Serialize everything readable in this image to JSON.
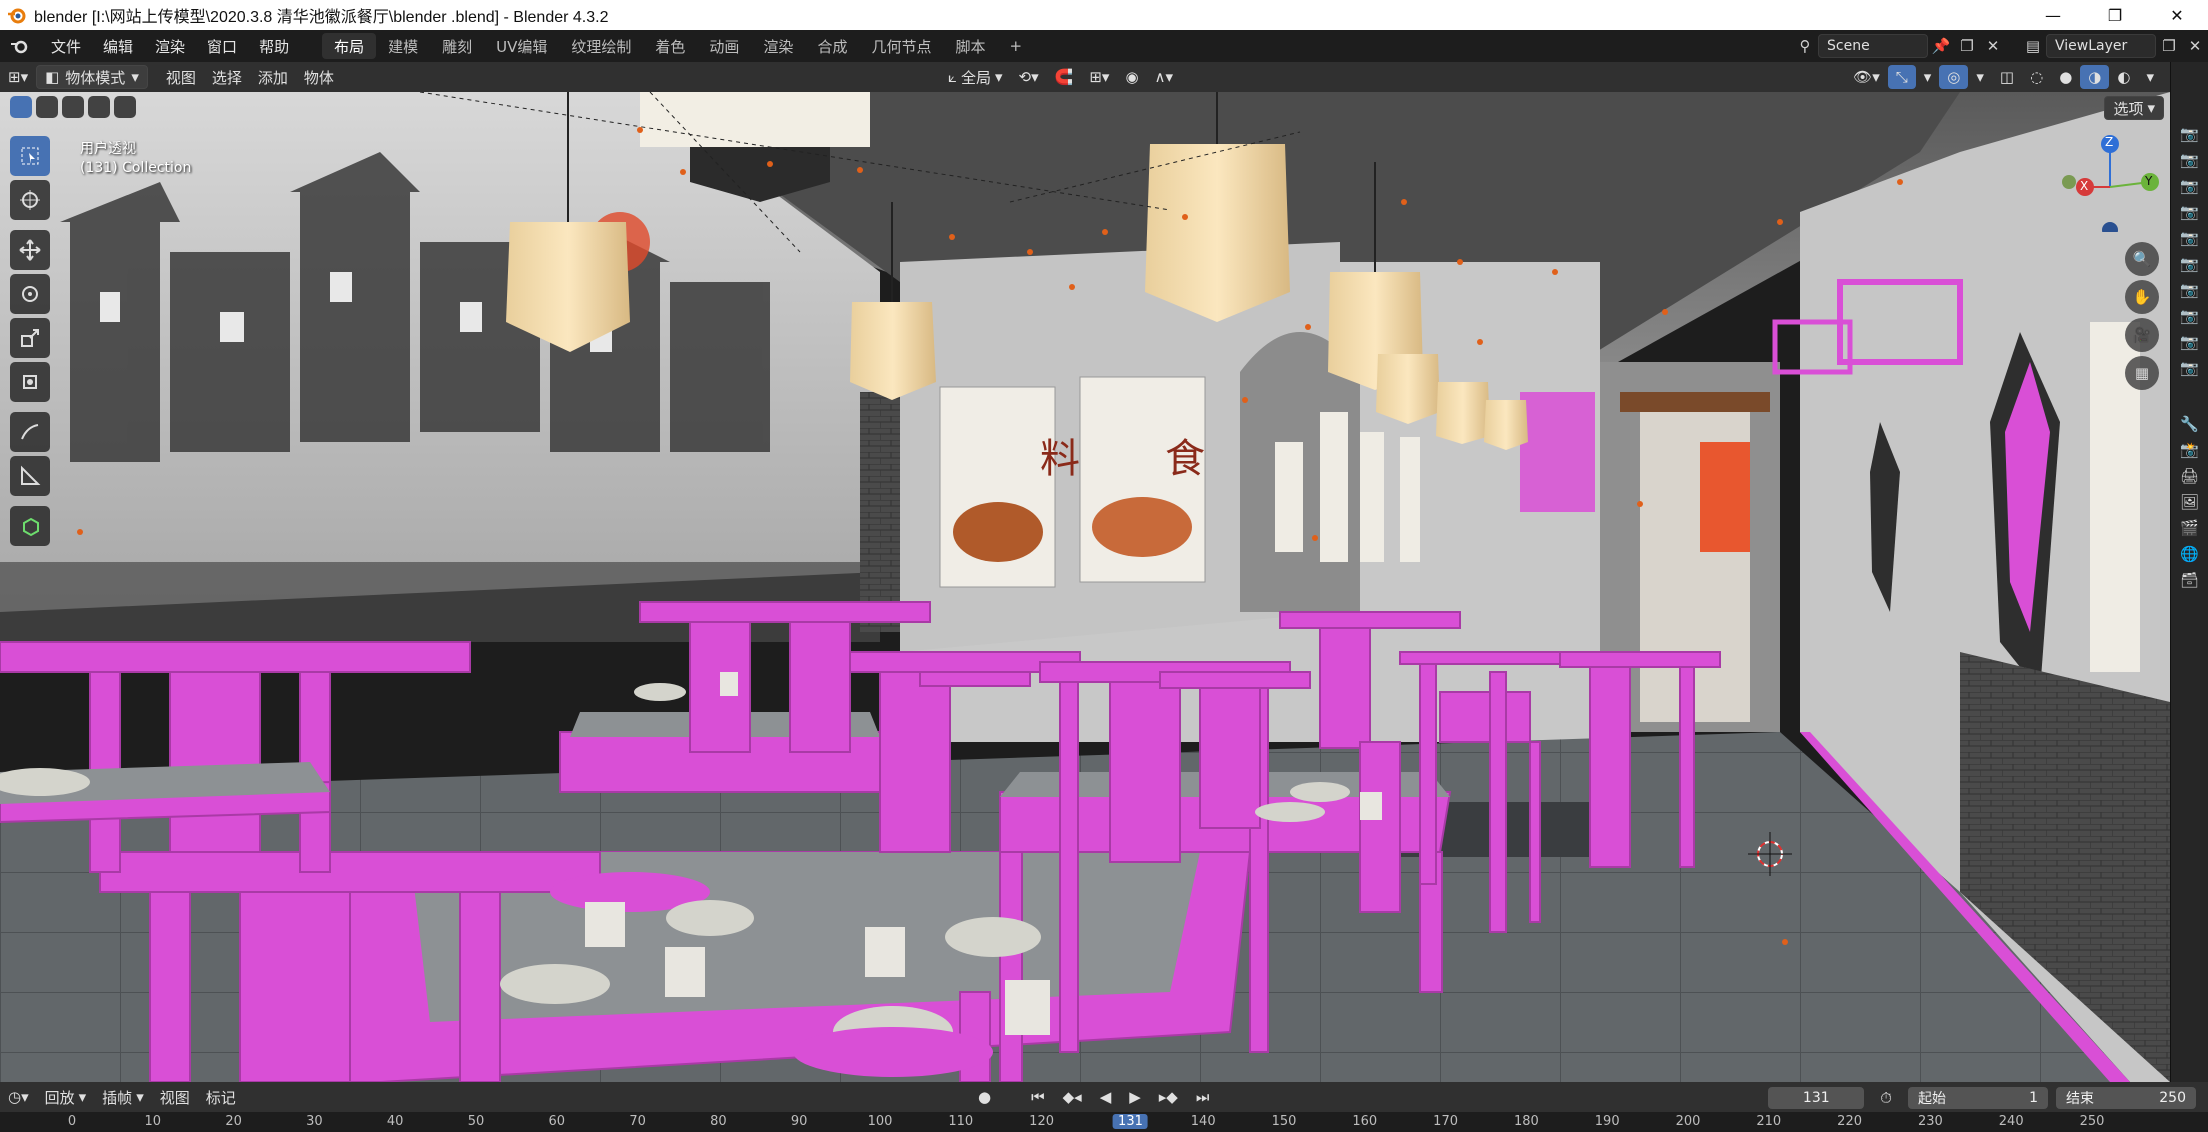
{
  "window": {
    "title": "blender  [I:\\网站上传模型\\2020.3.8 清华池徽派餐厅\\blender .blend] - Blender 4.3.2",
    "controls": [
      "minimize-icon",
      "maximize-icon",
      "close-icon"
    ]
  },
  "topbar": {
    "menus": [
      "文件",
      "编辑",
      "渲染",
      "窗口",
      "帮助"
    ],
    "workspaces": [
      "布局",
      "建模",
      "雕刻",
      "UV编辑",
      "纹理绘制",
      "着色",
      "动画",
      "渲染",
      "合成",
      "几何节点",
      "脚本"
    ],
    "active_workspace": "布局",
    "add_tab": "+",
    "scene": "Scene",
    "view_layer": "ViewLayer"
  },
  "viewport_header": {
    "mode": "物体模式",
    "menus": [
      "视图",
      "选择",
      "添加",
      "物体"
    ],
    "transform_orientation": "全局",
    "options": "选项"
  },
  "viewport": {
    "view_name": "用户透视",
    "collection": "(131) Collection",
    "gizmo_axes": {
      "x": "X",
      "y": "Y",
      "z": "Z"
    },
    "tools": [
      "select-box-icon",
      "cursor-icon",
      "move-icon",
      "rotate-icon",
      "scale-icon",
      "transform-icon",
      "annotate-icon",
      "measure-icon",
      "add-cube-icon"
    ]
  },
  "timeline": {
    "menus": [
      "回放",
      "插帧",
      "视图",
      "标记"
    ],
    "current_frame": "131",
    "start_label": "起始",
    "start": "1",
    "end_label": "结束",
    "end": "250",
    "ruler": [
      0,
      10,
      20,
      30,
      40,
      50,
      60,
      70,
      80,
      90,
      100,
      110,
      120,
      131,
      140,
      150,
      160,
      170,
      180,
      190,
      200,
      210,
      220,
      230,
      240,
      250
    ]
  },
  "colors": {
    "accent": "#4772b3",
    "furniture": "#d94fd6",
    "background": "#1d1d1d"
  }
}
